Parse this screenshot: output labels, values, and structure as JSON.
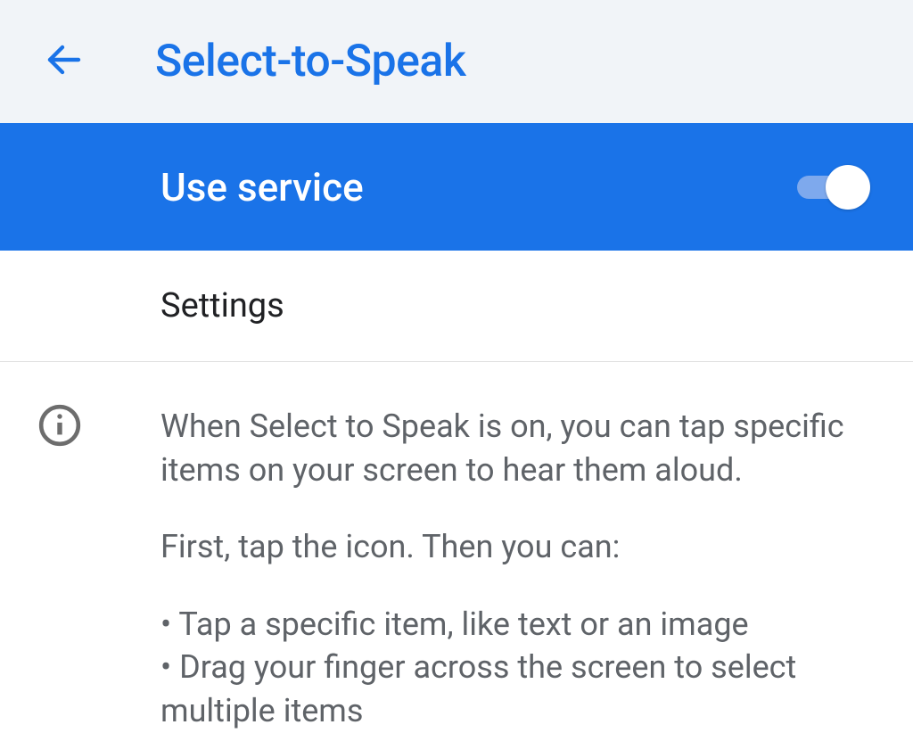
{
  "header": {
    "title": "Select-to-Speak"
  },
  "service": {
    "label": "Use service",
    "enabled": true
  },
  "settings": {
    "label": "Settings"
  },
  "info": {
    "para1": "When Select to Speak is on, you can tap specific items on your screen to hear them aloud.",
    "para2": "First, tap the icon. Then you can:",
    "bullet1": "• Tap a specific item, like text or an image",
    "bullet2": "• Drag your finger across the screen to select multiple items"
  },
  "colors": {
    "accent": "#1a73e8",
    "header_bg": "#f1f4f8",
    "text_secondary": "#5f6368"
  }
}
